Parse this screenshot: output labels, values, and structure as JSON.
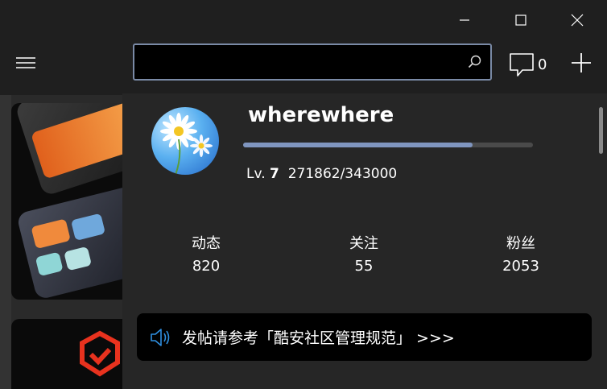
{
  "window": {
    "minimize_icon": "minimize-icon",
    "maximize_icon": "maximize-icon",
    "close_icon": "close-icon"
  },
  "header": {
    "menu_icon": "hamburger-menu-icon",
    "search": {
      "value": "",
      "placeholder": ""
    },
    "search_icon": "search-icon",
    "messages": {
      "icon": "chat-bubble-icon",
      "count": "0"
    },
    "add_icon": "plus-icon"
  },
  "user": {
    "name": "wherewhere",
    "level_prefix": "Lv.",
    "level": "7",
    "experience": "271862/343000",
    "progress": 0.793,
    "avatar": "daisy-avatar"
  },
  "stats": [
    {
      "label": "动态",
      "value": "820"
    },
    {
      "label": "关注",
      "value": "55"
    },
    {
      "label": "粉丝",
      "value": "2053"
    }
  ],
  "notice": {
    "icon": "speaker-icon",
    "text": "发帖请参考「酷安社区管理规范」 >>>"
  },
  "colors": {
    "accent": "#7f95bf",
    "search_border": "#7a8aa6",
    "panel_bg": "#262626",
    "notice_bg": "#000000",
    "speaker_blue": "#2f8fe0",
    "logo_red": "#e8321e"
  }
}
